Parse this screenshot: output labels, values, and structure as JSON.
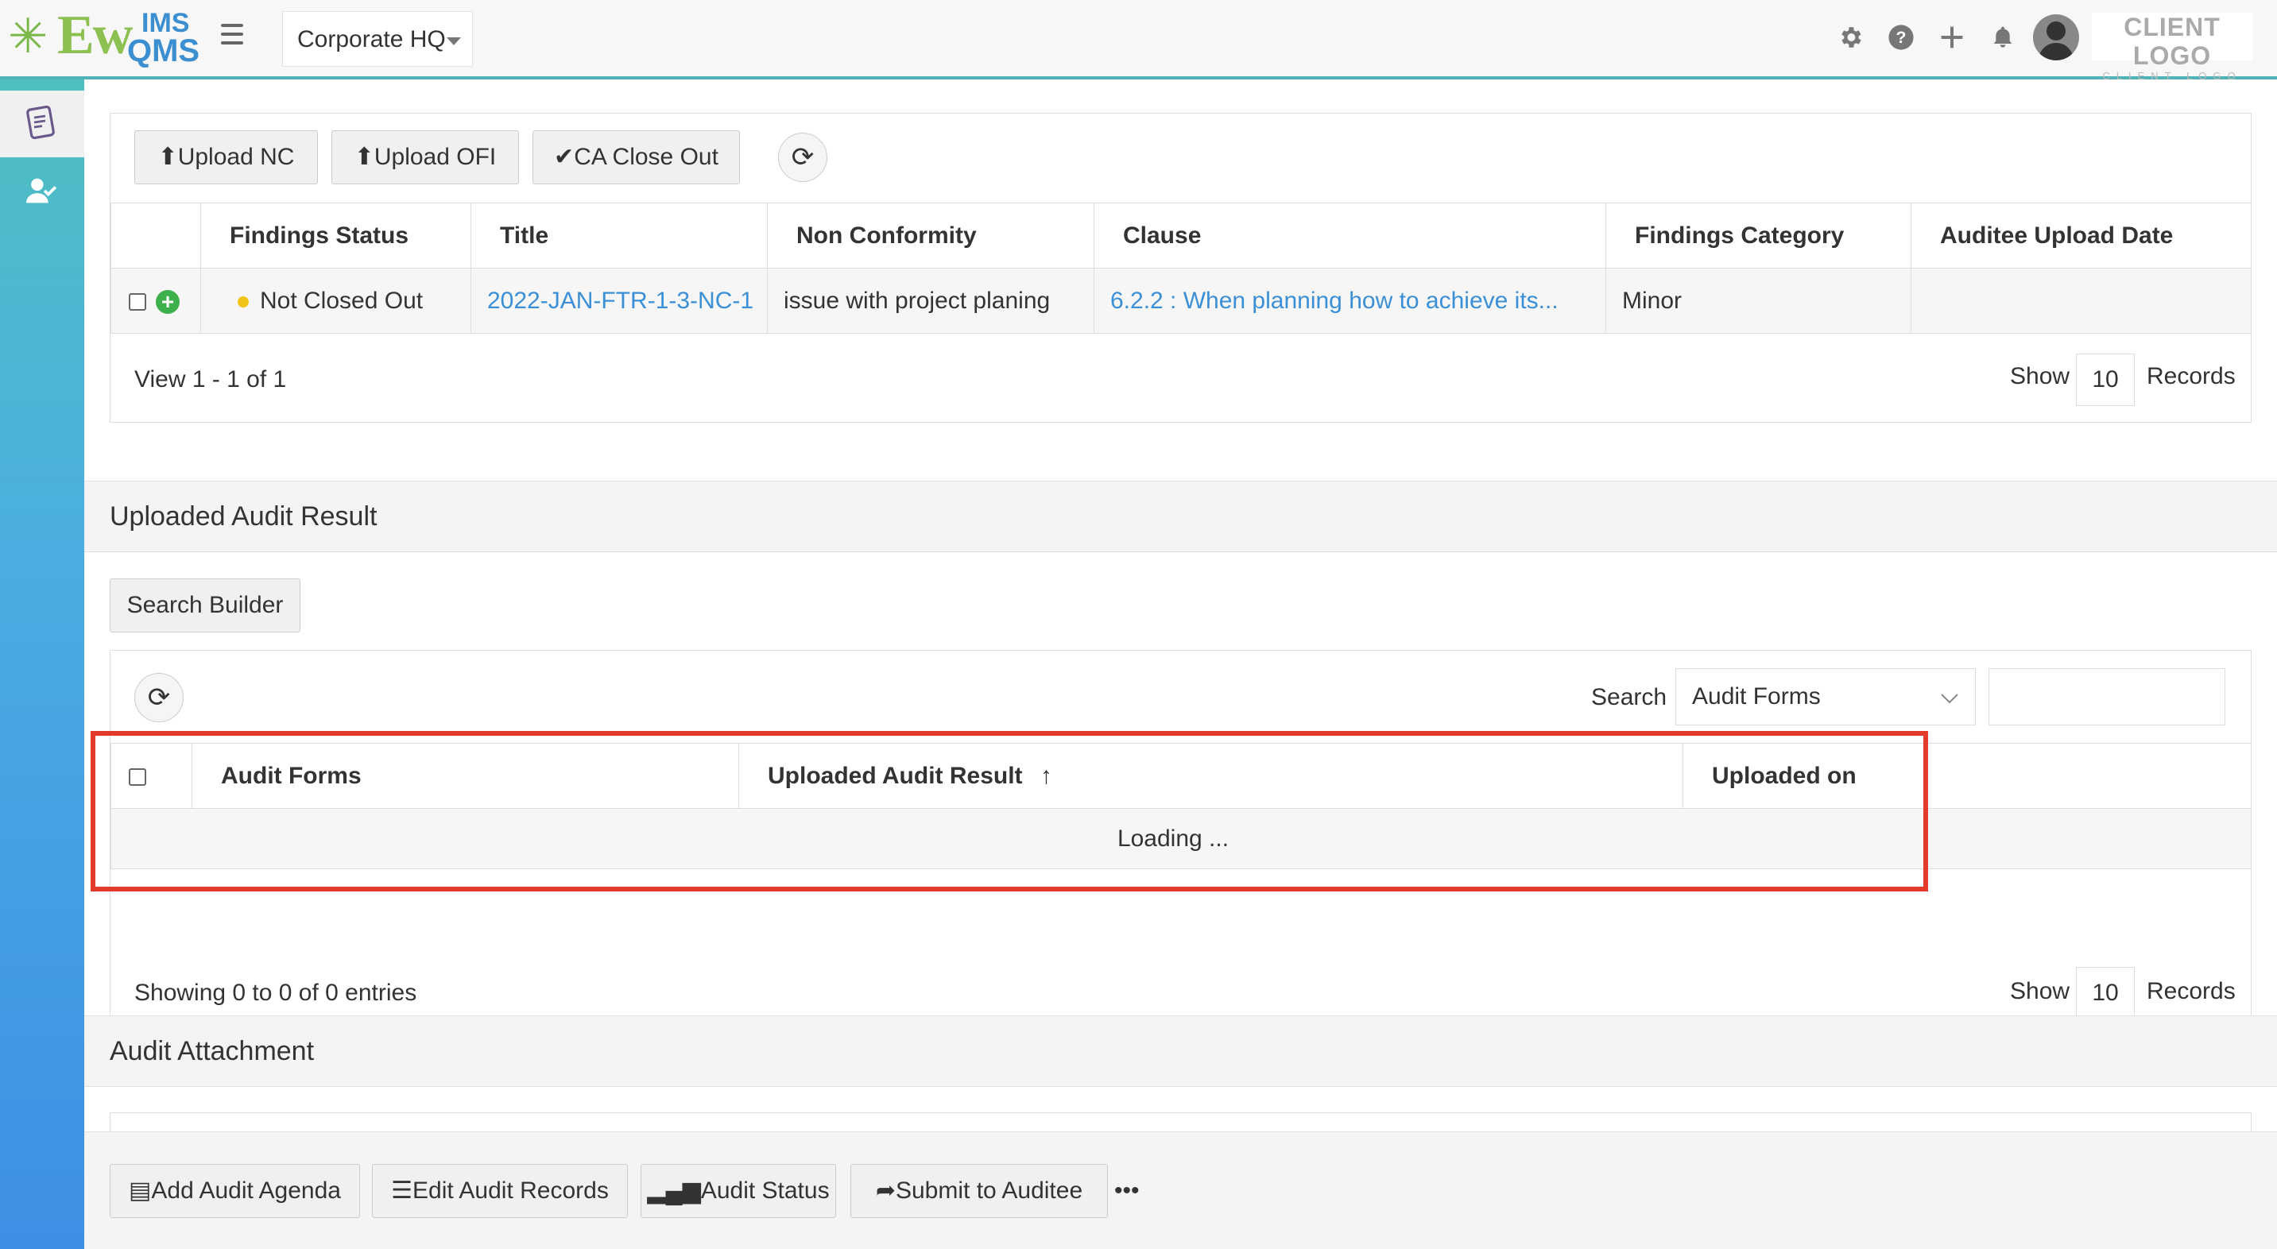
{
  "header": {
    "logo": {
      "ew": "Ew",
      "ims": "IMS",
      "qms": "QMS"
    },
    "site_selector": "Corporate HQ",
    "client_logo_main": "CLIENT LOGO",
    "client_logo_sub": "CLIENT LOGO",
    "icons": [
      "gear-icon",
      "help-icon",
      "plus-icon",
      "bell-icon",
      "avatar"
    ]
  },
  "sidebar": {
    "items": [
      {
        "icon": "audit-document-icon",
        "active": true
      },
      {
        "icon": "user-check-icon",
        "active": false
      }
    ]
  },
  "findings": {
    "buttons": {
      "upload_nc": "Upload NC",
      "upload_ofi": "Upload OFI",
      "ca_close_out": "CA Close Out"
    },
    "columns": [
      "Findings Status",
      "Title",
      "Non Conformity",
      "Clause",
      "Findings Category",
      "Auditee Upload Date"
    ],
    "rows": [
      {
        "status": "Not Closed Out",
        "title": "2022-JAN-FTR-1-3-NC-1",
        "non_conformity": "issue with project planing",
        "clause": "6.2.2 : When planning how to achieve its...",
        "category": "Minor",
        "upload_date": ""
      }
    ],
    "pager_text": "View 1 - 1 of 1",
    "show_label": "Show",
    "records_count": "10",
    "records_label": "Records"
  },
  "uploaded_audit_result": {
    "section_title": "Uploaded Audit Result",
    "search_builder": "Search Builder",
    "search_label": "Search",
    "search_field_select": "Audit Forms",
    "search_input_value": "",
    "columns": [
      "Audit Forms",
      "Uploaded Audit Result",
      "Uploaded on"
    ],
    "sort_indicator": "↑",
    "loading_text": "Loading ...",
    "pager_text": "Showing 0 to 0 of 0 entries",
    "show_label": "Show",
    "records_count": "10",
    "records_label": "Records"
  },
  "audit_attachment": {
    "section_title": "Audit Attachment"
  },
  "bottom_bar": {
    "add_audit_agenda": "Add Audit Agenda",
    "edit_audit_records": "Edit Audit Records",
    "audit_status": "Audit Status",
    "submit_to_auditee": "Submit to Auditee",
    "more": "•••"
  },
  "colors": {
    "accent": "#4fb3b8",
    "link": "#3a8fd6",
    "highlight": "#e23b2a",
    "status_dot": "#f0c419",
    "add_green": "#3db04b"
  }
}
